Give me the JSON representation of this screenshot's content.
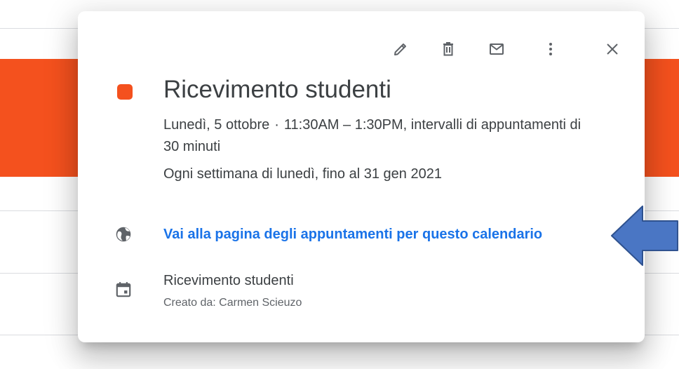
{
  "colors": {
    "event": "#f4511e",
    "link": "#1a73e8",
    "text": "#3c4043",
    "secondary_text": "#5f6368",
    "icon": "#5f6368",
    "annotation_arrow": "#4a76c4"
  },
  "toolbar": {
    "edit_icon": "pencil-icon",
    "delete_icon": "trash-icon",
    "email_icon": "envelope-icon",
    "more_icon": "more-vertical-icon",
    "close_icon": "close-icon"
  },
  "event": {
    "title": "Ricevimento studenti",
    "date": "Lunedì, 5 ottobre",
    "separator": "·",
    "time": "11:30AM – 1:30PM, intervalli di appuntamenti di 30 minuti",
    "recurrence": "Ogni settimana di lunedì, fino al 31 gen 2021"
  },
  "appointment_link": {
    "icon": "globe-icon",
    "text": "Vai alla pagina degli appuntamenti per questo calendario"
  },
  "calendar": {
    "icon": "calendar-icon",
    "name": "Ricevimento studenti",
    "creator": "Creato da: Carmen Scieuzo"
  }
}
